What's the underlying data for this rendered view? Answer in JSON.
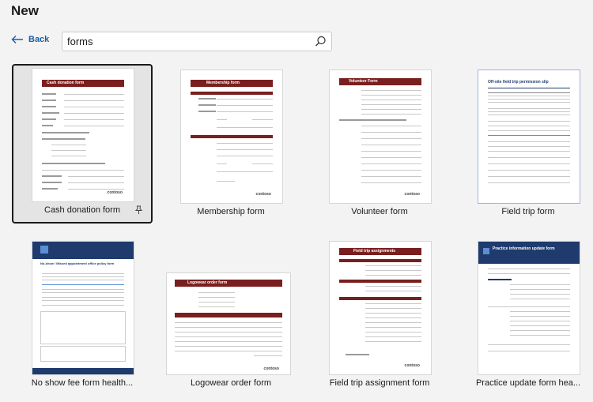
{
  "page": {
    "title": "New"
  },
  "nav": {
    "back_label": "Back"
  },
  "search": {
    "value": "forms"
  },
  "templates": [
    {
      "label": "Cash donation form",
      "thumb_heading": "Cash donation form"
    },
    {
      "label": "Membership form",
      "thumb_heading": "Membership form"
    },
    {
      "label": "Volunteer form",
      "thumb_heading": "Volunteer Form"
    },
    {
      "label": "Field trip form",
      "thumb_heading": "Off-site field trip permission slip"
    },
    {
      "label": "No show fee form health...",
      "thumb_heading": "No-show / Missed appointment office policy form"
    },
    {
      "label": "Logowear order form",
      "thumb_heading": "Logowear order form"
    },
    {
      "label": "Field trip assignment form",
      "thumb_heading": "Field trip assignments"
    },
    {
      "label": "Practice update form hea...",
      "thumb_heading": "Practice information update form"
    }
  ],
  "thumb_logo_text": "contoso",
  "colors": {
    "accent_link": "#1a5ea8",
    "thumb_header": "#7a1f1f",
    "thumb_blue": "#1f3b6e"
  }
}
